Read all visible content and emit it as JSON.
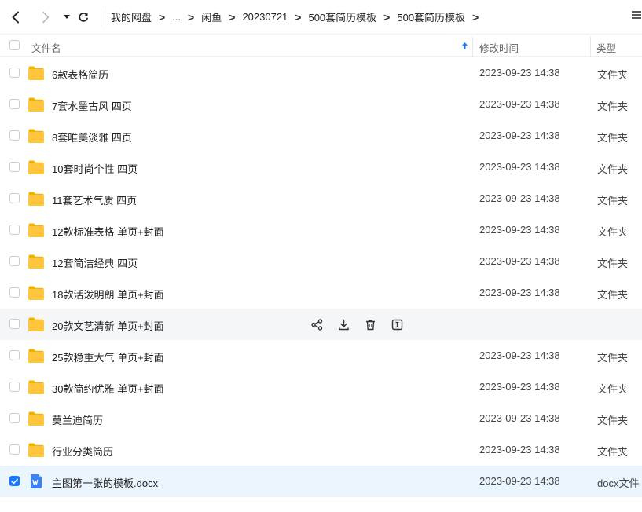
{
  "breadcrumbs": [
    "我的网盘",
    "...",
    "闲鱼",
    "20230721",
    "500套简历模板",
    "500套简历模板"
  ],
  "columns": {
    "name": "文件名",
    "modified": "修改时间",
    "type": "类型"
  },
  "files": [
    {
      "name": "6款表格简历",
      "modified": "2023-09-23 14:38",
      "type": "文件夹",
      "icon": "folder-icon"
    },
    {
      "name": "7套水墨古风 四页",
      "modified": "2023-09-23 14:38",
      "type": "文件夹",
      "icon": "folder-icon"
    },
    {
      "name": "8套唯美淡雅 四页",
      "modified": "2023-09-23 14:38",
      "type": "文件夹",
      "icon": "folder-icon"
    },
    {
      "name": "10套时尚个性 四页",
      "modified": "2023-09-23 14:38",
      "type": "文件夹",
      "icon": "folder-icon"
    },
    {
      "name": "11套艺术气质 四页",
      "modified": "2023-09-23 14:38",
      "type": "文件夹",
      "icon": "folder-icon"
    },
    {
      "name": "12款标准表格 单页+封面",
      "modified": "2023-09-23 14:38",
      "type": "文件夹",
      "icon": "folder-icon"
    },
    {
      "name": "12套简洁经典 四页",
      "modified": "2023-09-23 14:38",
      "type": "文件夹",
      "icon": "folder-icon"
    },
    {
      "name": "18款活泼明朗 单页+封面",
      "modified": "2023-09-23 14:38",
      "type": "文件夹",
      "icon": "folder-icon"
    },
    {
      "name": "20款文艺清新 单页+封面",
      "modified": "",
      "type": "",
      "icon": "folder-icon",
      "hovered": true
    },
    {
      "name": "25款稳重大气 单页+封面",
      "modified": "2023-09-23 14:38",
      "type": "文件夹",
      "icon": "folder-icon"
    },
    {
      "name": "30款简约优雅 单页+封面",
      "modified": "2023-09-23 14:38",
      "type": "文件夹",
      "icon": "folder-icon"
    },
    {
      "name": "莫兰迪简历",
      "modified": "2023-09-23 14:38",
      "type": "文件夹",
      "icon": "folder-icon"
    },
    {
      "name": "行业分类简历",
      "modified": "2023-09-23 14:38",
      "type": "文件夹",
      "icon": "folder-icon"
    },
    {
      "name": "主图第一张的模板.docx",
      "modified": "2023-09-23 14:38",
      "type": "docx文件",
      "icon": "word-doc-icon",
      "selected": true
    }
  ],
  "hover_actions": [
    "share-icon",
    "download-icon",
    "delete-icon",
    "rename-icon"
  ],
  "colors": {
    "accent": "#1677ff",
    "folder": "#ffc53d",
    "selected_row": "#ebf5fe",
    "hover_row": "#f5f6f8"
  }
}
